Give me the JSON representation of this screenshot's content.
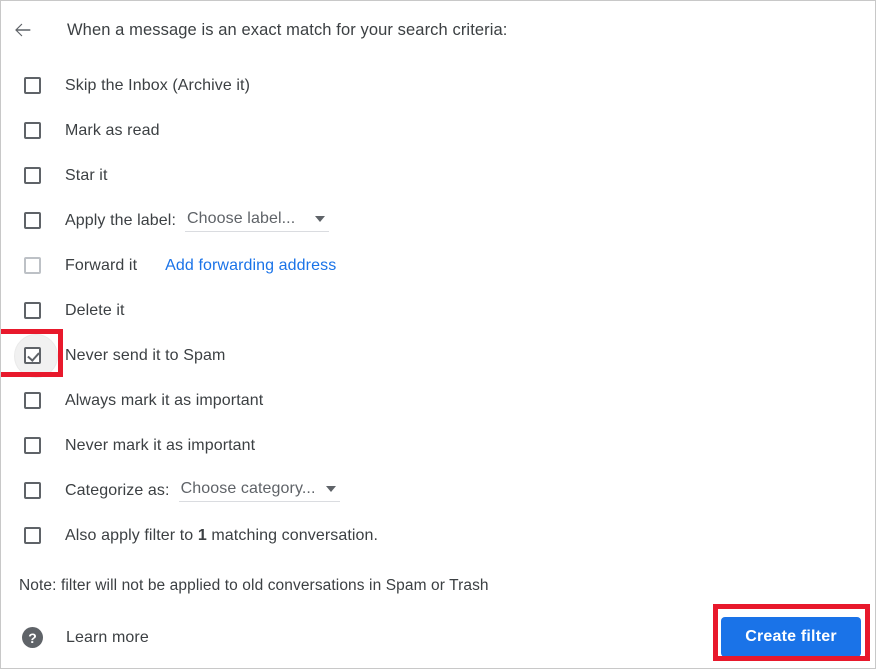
{
  "header": {
    "back_icon": "arrow-left-icon",
    "title": "When a message is an exact match for your search criteria:"
  },
  "options": [
    {
      "id": "skip-inbox",
      "label": "Skip the Inbox (Archive it)",
      "checked": false,
      "disabled": false
    },
    {
      "id": "mark-as-read",
      "label": "Mark as read",
      "checked": false,
      "disabled": false
    },
    {
      "id": "star-it",
      "label": "Star it",
      "checked": false,
      "disabled": false
    },
    {
      "id": "apply-label",
      "label": "Apply the label:",
      "checked": false,
      "disabled": false,
      "dropdown": "Choose label..."
    },
    {
      "id": "forward-it",
      "label": "Forward it",
      "checked": false,
      "disabled": true,
      "link": "Add forwarding address"
    },
    {
      "id": "delete-it",
      "label": "Delete it",
      "checked": false,
      "disabled": false
    },
    {
      "id": "never-spam",
      "label": "Never send it to Spam",
      "checked": true,
      "disabled": false,
      "highlighted": true
    },
    {
      "id": "always-important",
      "label": "Always mark it as important",
      "checked": false,
      "disabled": false
    },
    {
      "id": "never-important",
      "label": "Never mark it as important",
      "checked": false,
      "disabled": false
    },
    {
      "id": "categorize-as",
      "label": "Categorize as:",
      "checked": false,
      "disabled": false,
      "dropdown": "Choose category..."
    },
    {
      "id": "also-apply",
      "label_before": "Also apply filter to ",
      "label_count": "1",
      "label_after": " matching conversation.",
      "checked": false,
      "disabled": false
    }
  ],
  "note": "Note: filter will not be applied to old conversations in Spam or Trash",
  "footer": {
    "help_icon": "help-circle-icon",
    "learn_more": "Learn more",
    "create_button": "Create filter"
  },
  "annotations": {
    "accent_color": "#e8192c",
    "checkbox_box": "never-send-it-to-spam-checkbox",
    "button_box": "create-filter-button"
  },
  "colors": {
    "primary_blue": "#1a73e8",
    "text": "#3c4043",
    "muted_text": "#5f6368",
    "annotation_red": "#e8192c"
  }
}
